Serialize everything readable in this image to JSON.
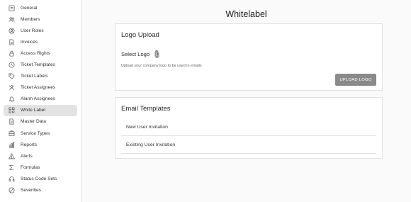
{
  "sidebar": {
    "items": [
      {
        "label": "General",
        "icon": "general-icon"
      },
      {
        "label": "Members",
        "icon": "members-icon"
      },
      {
        "label": "User Roles",
        "icon": "user-roles-icon"
      },
      {
        "label": "Invoices",
        "icon": "invoice-icon"
      },
      {
        "label": "Access Rights",
        "icon": "lock-icon"
      },
      {
        "label": "Ticket Templates",
        "icon": "ticket-template-icon"
      },
      {
        "label": "Ticket Labels",
        "icon": "label-icon"
      },
      {
        "label": "Ticket Assignees",
        "icon": "assignee-icon"
      },
      {
        "label": "Alarm Assignees",
        "icon": "alarm-icon"
      },
      {
        "label": "White Label",
        "icon": "white-label-icon",
        "active": true
      },
      {
        "label": "Master Data",
        "icon": "master-data-icon"
      },
      {
        "label": "Service Types",
        "icon": "service-types-icon"
      },
      {
        "label": "Reports",
        "icon": "reports-icon"
      },
      {
        "label": "Alerts",
        "icon": "alert-icon"
      },
      {
        "label": "Formulas",
        "icon": "sigma-icon"
      },
      {
        "label": "Status Code Sets",
        "icon": "status-code-icon"
      },
      {
        "label": "Severities",
        "icon": "severity-icon"
      }
    ]
  },
  "main": {
    "title": "Whitelabel",
    "logo_upload": {
      "title": "Logo Upload",
      "select_label": "Select Logo",
      "hint": "Upload your company logo to be used in emails",
      "button": "UPLOAD LOGO"
    },
    "email_templates": {
      "title": "Email Templates",
      "items": [
        "New User Invitation",
        "Existing User Invitation"
      ]
    }
  },
  "colors": {
    "active_nav_bg": "#e3e3e3",
    "button_bg": "#8a8a8a"
  }
}
